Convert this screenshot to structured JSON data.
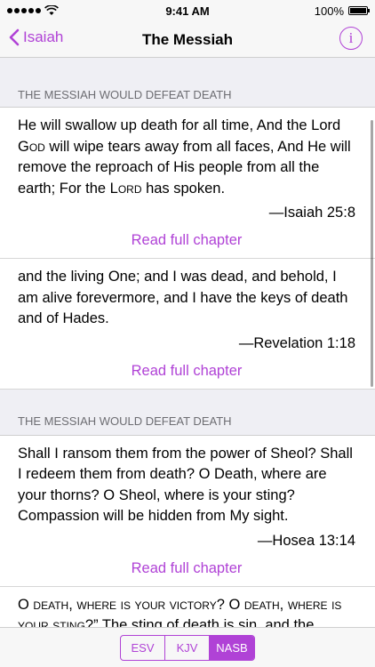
{
  "status_bar": {
    "time": "9:41 AM",
    "battery": "100%",
    "battery_level": 1.0
  },
  "nav": {
    "back_label": "Isaiah",
    "title": "The Messiah",
    "info_icon": "i"
  },
  "sections": [
    {
      "header": "THE MESSIAH WOULD DEFEAT DEATH",
      "verses": [
        {
          "text": "He will swallow up death for all time, And the Lord ",
          "sc1": "God",
          "text2": " will wipe tears away from all faces, And He will remove the reproach of His people from all the earth; For the ",
          "sc2": "Lord",
          "text3": " has spoken.",
          "reference": "—Isaiah 25:8",
          "link": "Read full chapter"
        },
        {
          "text": "and the living One; and I was dead, and behold, I am alive forevermore, and I have the keys of death and of Hades.",
          "reference": "—Revelation 1:18",
          "link": "Read full chapter"
        }
      ]
    },
    {
      "header": "THE MESSIAH WOULD DEFEAT DEATH",
      "verses": [
        {
          "text": "Shall I ransom them from the power of Sheol? Shall I redeem them from death? O Death, where are your thorns? O Sheol, where is your sting? Compassion will be hidden from My sight.",
          "reference": "—Hosea 13:14",
          "link": "Read full chapter"
        },
        {
          "sc_text": "O death, where is your victory? O death, where is your sting?",
          "text": "” The sting of death is sin, and the power of sin is the law; but thanks be to"
        }
      ]
    }
  ],
  "toolbar": {
    "versions": [
      "ESV",
      "KJV",
      "NASB"
    ],
    "selected": "NASB"
  },
  "colors": {
    "accent": "#b042d6",
    "section_bg": "#efeff4",
    "header_text": "#6d6d72"
  }
}
